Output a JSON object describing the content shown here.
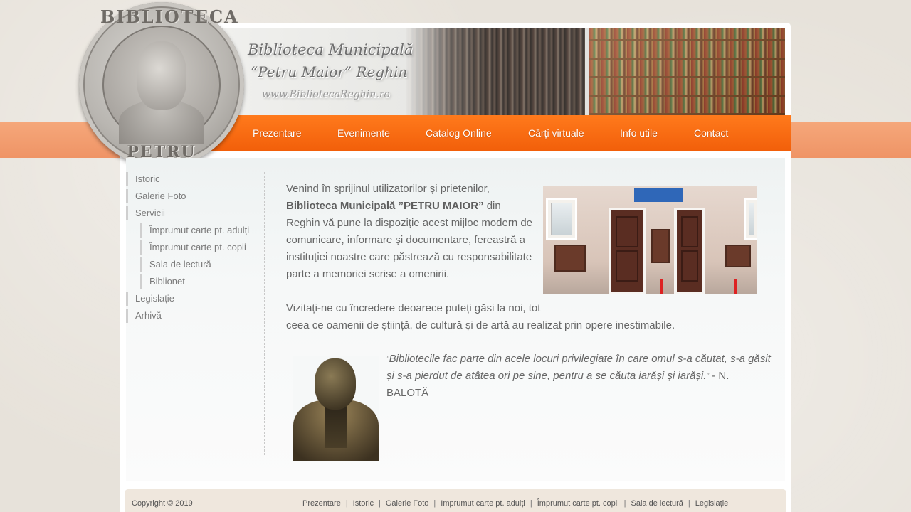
{
  "header": {
    "title_line1": "Biblioteca Municipală",
    "title_line2": "“Petru Maior” Reghin",
    "website": "www.BibliotecaReghin.ro",
    "seal_top": "BIBLIOTECA",
    "seal_bottom": "PETRU MAIOR"
  },
  "nav": {
    "items": [
      "Prezentare",
      "Evenimente",
      "Catalog Online",
      "Cărți virtuale",
      "Info utile",
      "Contact"
    ]
  },
  "sidebar": {
    "items": [
      "Istoric",
      "Galerie Foto",
      "Servicii",
      "Împrumut carte pt. adulți",
      "Împrumut carte pt. copii",
      "Sala de lectură",
      "Biblionet",
      "Legislație",
      "Arhivă"
    ]
  },
  "main": {
    "intro_prefix": "Venind în sprijinul utilizatorilor și prietenilor, ",
    "intro_bold": "Biblioteca Municipală ”PETRU MAIOR”",
    "intro_suffix": " din Reghin vă pune la dispoziție acest mijloc modern de comunicare, informare și documentare, fereastră a instituției noastre care păstrează cu responsabilitate parte a memoriei scrise a omenirii.",
    "visit_line1": "Vizitați-ne cu încredere deoarece puteți găsi la noi, tot",
    "visit_line2": "ceea ce oamenii de știință, de cultură și de artă au realizat prin opere inestimabile.",
    "quote_open": "”",
    "quote_text": "Bibliotecile fac parte din acele locuri privilegiate în care omul s-a căutat, s-a găsit și s-a pierdut de atâtea ori pe sine, pentru a se căuta iarăși și iarăși.",
    "quote_close": "”",
    "quote_author": " - N. BALOTĂ"
  },
  "footer": {
    "copyright": "Copyright © 2019",
    "links": [
      "Prezentare",
      "Istoric",
      "Galerie Foto",
      "Imprumut carte pt. adulți",
      "Împrumut carte pt. copii",
      "Sala de lectură",
      "Legislație"
    ],
    "separator": "|"
  },
  "colors": {
    "nav_orange": "#f56a10",
    "band_orange": "#f29a6c",
    "page_bg": "#e7e2da"
  }
}
